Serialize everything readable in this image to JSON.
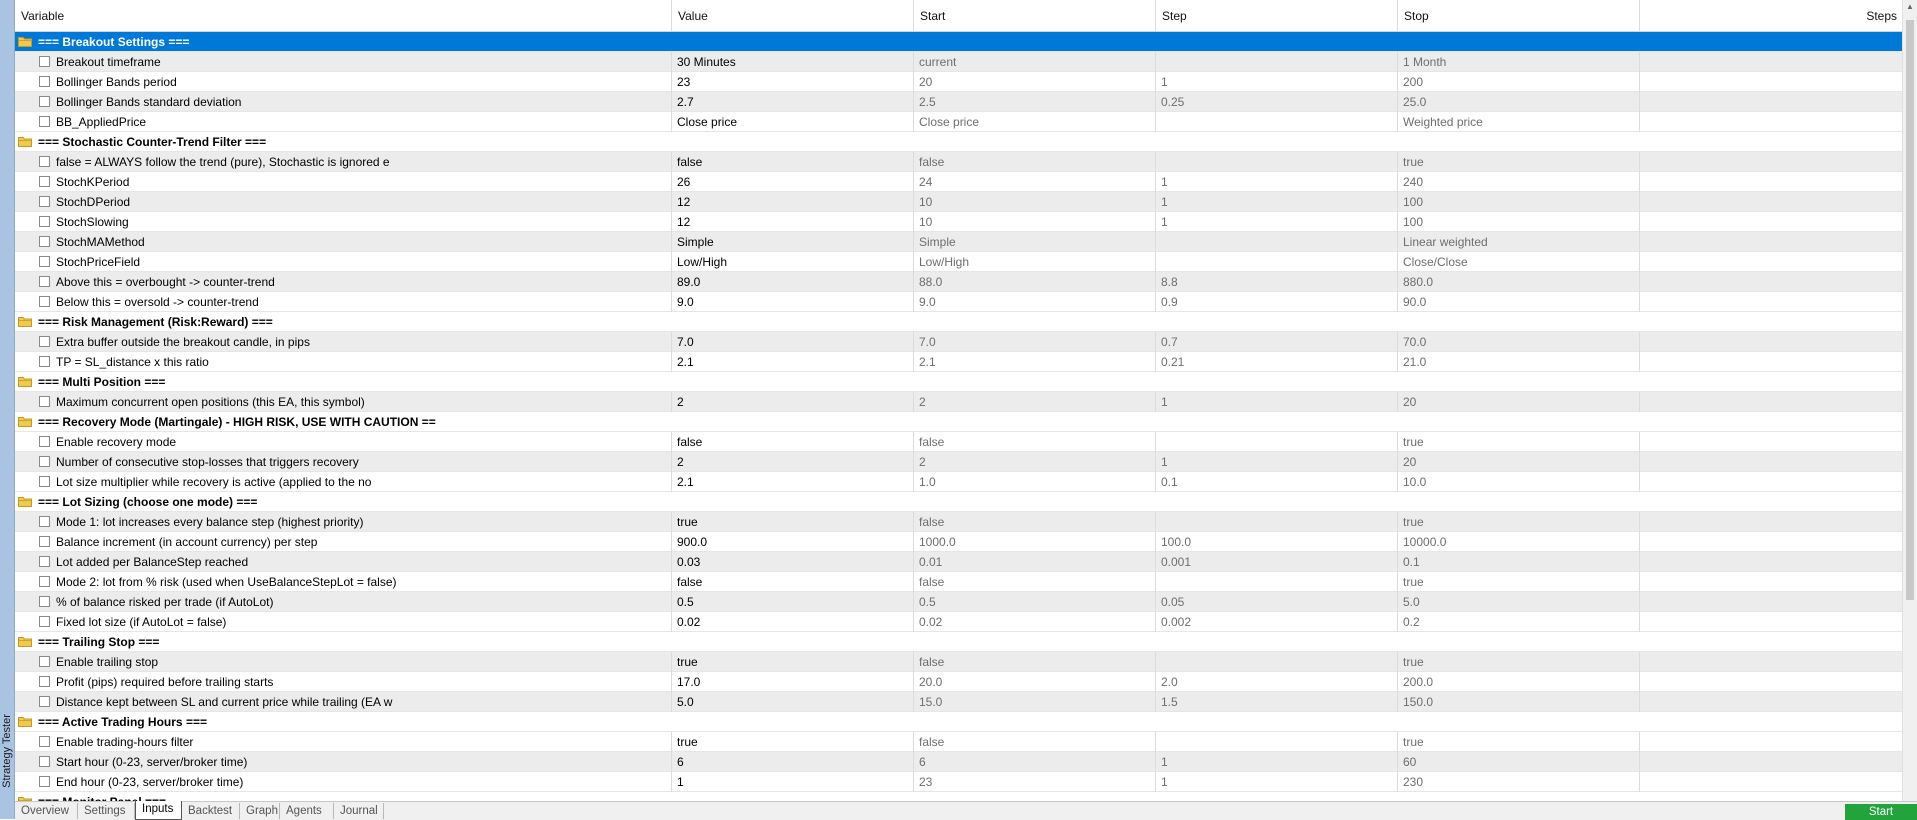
{
  "window": {
    "side_label": "Strategy Tester"
  },
  "columns": {
    "variable": "Variable",
    "value": "Value",
    "start": "Start",
    "step": "Step",
    "stop": "Stop",
    "steps": "Steps"
  },
  "rows": [
    {
      "type": "section",
      "label": "=== Breakout Settings ===",
      "selected": true
    },
    {
      "type": "param",
      "label": "Breakout timeframe",
      "value": "30 Minutes",
      "start": "current",
      "step": "",
      "stop": "1 Month"
    },
    {
      "type": "param",
      "label": "Bollinger Bands period",
      "value": "23",
      "start": "20",
      "step": "1",
      "stop": "200"
    },
    {
      "type": "param",
      "label": "Bollinger Bands standard deviation",
      "value": "2.7",
      "start": "2.5",
      "step": "0.25",
      "stop": "25.0"
    },
    {
      "type": "param",
      "label": "BB_AppliedPrice",
      "value": "Close price",
      "start": "Close price",
      "step": "",
      "stop": "Weighted price"
    },
    {
      "type": "section",
      "label": "=== Stochastic Counter-Trend Filter ==="
    },
    {
      "type": "param",
      "label": "false = ALWAYS follow the trend (pure), Stochastic is ignored e",
      "value": "false",
      "start": "false",
      "step": "",
      "stop": "true"
    },
    {
      "type": "param",
      "label": "StochKPeriod",
      "value": "26",
      "start": "24",
      "step": "1",
      "stop": "240"
    },
    {
      "type": "param",
      "label": "StochDPeriod",
      "value": "12",
      "start": "10",
      "step": "1",
      "stop": "100"
    },
    {
      "type": "param",
      "label": "StochSlowing",
      "value": "12",
      "start": "10",
      "step": "1",
      "stop": "100"
    },
    {
      "type": "param",
      "label": "StochMAMethod",
      "value": "Simple",
      "start": "Simple",
      "step": "",
      "stop": "Linear weighted"
    },
    {
      "type": "param",
      "label": "StochPriceField",
      "value": "Low/High",
      "start": "Low/High",
      "step": "",
      "stop": "Close/Close"
    },
    {
      "type": "param",
      "label": "Above this = overbought -> counter-trend",
      "value": "89.0",
      "start": "88.0",
      "step": "8.8",
      "stop": "880.0"
    },
    {
      "type": "param",
      "label": "Below this = oversold -> counter-trend",
      "value": "9.0",
      "start": "9.0",
      "step": "0.9",
      "stop": "90.0"
    },
    {
      "type": "section",
      "label": "=== Risk Management (Risk:Reward) ==="
    },
    {
      "type": "param",
      "label": "Extra buffer outside the breakout candle, in pips",
      "value": "7.0",
      "start": "7.0",
      "step": "0.7",
      "stop": "70.0"
    },
    {
      "type": "param",
      "label": "TP = SL_distance x this ratio",
      "value": "2.1",
      "start": "2.1",
      "step": "0.21",
      "stop": "21.0"
    },
    {
      "type": "section",
      "label": "=== Multi Position ==="
    },
    {
      "type": "param",
      "label": "Maximum concurrent open positions (this EA, this symbol)",
      "value": "2",
      "start": "2",
      "step": "1",
      "stop": "20"
    },
    {
      "type": "section",
      "label": "=== Recovery Mode (Martingale) - HIGH RISK, USE WITH CAUTION =="
    },
    {
      "type": "param",
      "label": "Enable recovery mode",
      "value": "false",
      "start": "false",
      "step": "",
      "stop": "true"
    },
    {
      "type": "param",
      "label": "Number of consecutive stop-losses that triggers recovery",
      "value": "2",
      "start": "2",
      "step": "1",
      "stop": "20"
    },
    {
      "type": "param",
      "label": "Lot size multiplier while recovery is active (applied to the no",
      "value": "2.1",
      "start": "1.0",
      "step": "0.1",
      "stop": "10.0"
    },
    {
      "type": "section",
      "label": "=== Lot Sizing (choose one mode) ==="
    },
    {
      "type": "param",
      "label": "Mode 1: lot increases every balance step (highest priority)",
      "value": "true",
      "start": "false",
      "step": "",
      "stop": "true"
    },
    {
      "type": "param",
      "label": "Balance increment (in account currency) per step",
      "value": "900.0",
      "start": "1000.0",
      "step": "100.0",
      "stop": "10000.0"
    },
    {
      "type": "param",
      "label": "Lot added per BalanceStep reached",
      "value": "0.03",
      "start": "0.01",
      "step": "0.001",
      "stop": "0.1"
    },
    {
      "type": "param",
      "label": "Mode 2: lot from % risk (used when UseBalanceStepLot = false)",
      "value": "false",
      "start": "false",
      "step": "",
      "stop": "true"
    },
    {
      "type": "param",
      "label": "% of balance risked per trade (if AutoLot)",
      "value": "0.5",
      "start": "0.5",
      "step": "0.05",
      "stop": "5.0"
    },
    {
      "type": "param",
      "label": "Fixed lot size (if AutoLot = false)",
      "value": "0.02",
      "start": "0.02",
      "step": "0.002",
      "stop": "0.2"
    },
    {
      "type": "section",
      "label": "=== Trailing Stop ==="
    },
    {
      "type": "param",
      "label": "Enable trailing stop",
      "value": "true",
      "start": "false",
      "step": "",
      "stop": "true"
    },
    {
      "type": "param",
      "label": "Profit (pips) required before trailing starts",
      "value": "17.0",
      "start": "20.0",
      "step": "2.0",
      "stop": "200.0"
    },
    {
      "type": "param",
      "label": "Distance kept between SL and current price while trailing (EA w",
      "value": "5.0",
      "start": "15.0",
      "step": "1.5",
      "stop": "150.0"
    },
    {
      "type": "section",
      "label": "=== Active Trading Hours ==="
    },
    {
      "type": "param",
      "label": "Enable trading-hours filter",
      "value": "true",
      "start": "false",
      "step": "",
      "stop": "true"
    },
    {
      "type": "param",
      "label": "Start hour (0-23, server/broker time)",
      "value": "6",
      "start": "6",
      "step": "1",
      "stop": "60"
    },
    {
      "type": "param",
      "label": "End hour (0-23, server/broker time)",
      "value": "1",
      "start": "23",
      "step": "1",
      "stop": "230"
    },
    {
      "type": "section",
      "label": "=== Monitor Panel ==="
    }
  ],
  "tabs": [
    {
      "label": "Overview",
      "active": false
    },
    {
      "label": "Settings",
      "active": false
    },
    {
      "label": "Inputs",
      "active": true
    },
    {
      "label": "Backtest",
      "active": false
    },
    {
      "label": "Graph",
      "active": false
    },
    {
      "label": "Agents",
      "active": false
    },
    {
      "label": "Journal",
      "active": false
    }
  ],
  "actions": {
    "start_label": "Start"
  },
  "colors": {
    "selection": "#0078d7",
    "start_button": "#23a33b",
    "sidebar": "#a9c3e3"
  }
}
